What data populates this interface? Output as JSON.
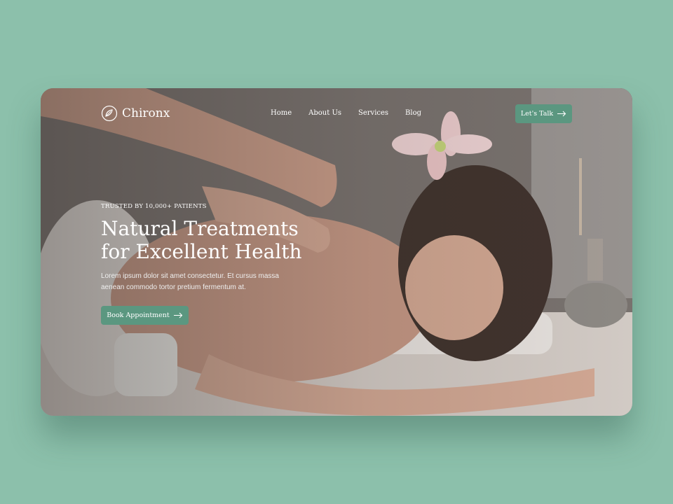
{
  "brand": {
    "name": "Chironx"
  },
  "nav": {
    "items": [
      "Home",
      "About Us",
      "Services",
      "Blog"
    ]
  },
  "cta": {
    "talk_label": "Let's Talk"
  },
  "hero": {
    "eyebrow": "TRUSTED BY 10,000+ PATIENTS",
    "title_line1": "Natural Treatments",
    "title_line2": "for Excellent Health",
    "subtitle_line1": "Lorem ipsum dolor sit amet consectetur. Et cursus massa",
    "subtitle_line2": "aenean commodo tortor pretium fermentum at.",
    "button_label": "Book Appointment"
  },
  "colors": {
    "background": "#8cc0ab",
    "accent": "#5b9780"
  },
  "icons": {
    "logo": "leaf-circle-icon",
    "arrow": "arrow-right-icon"
  }
}
